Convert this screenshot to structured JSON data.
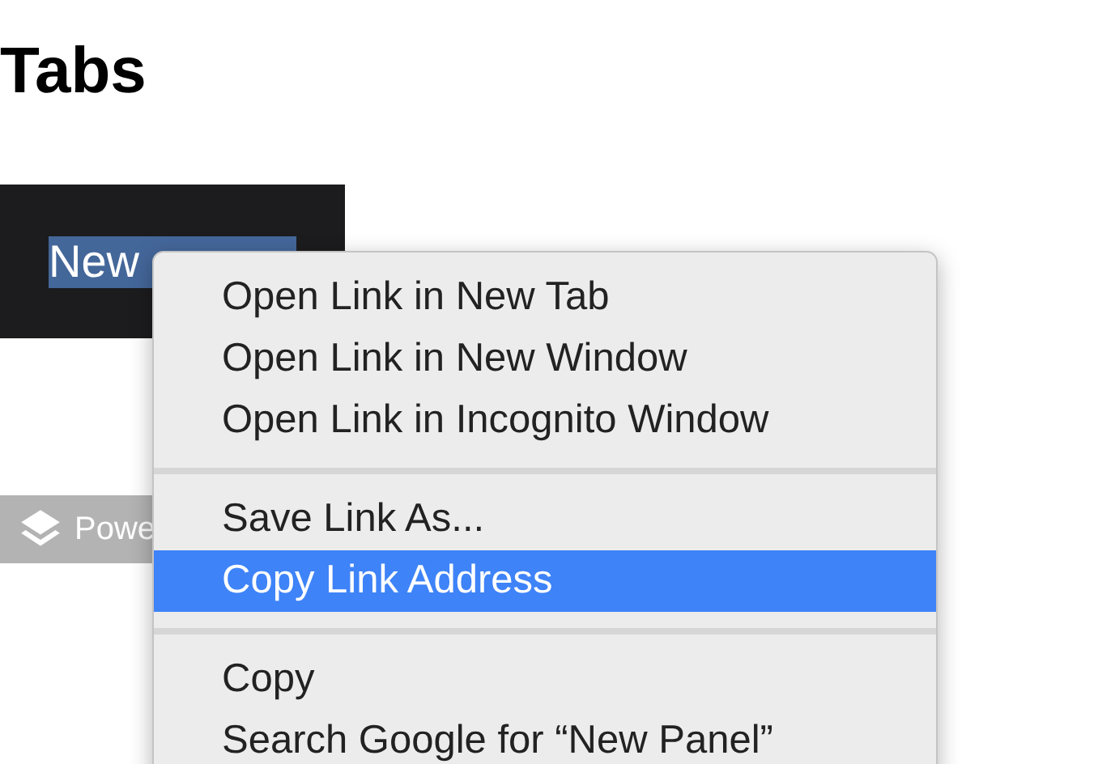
{
  "heading": "Tabs",
  "panel": {
    "tab_label": "New",
    "selected": true
  },
  "badge": {
    "label": "Powe"
  },
  "context_menu": {
    "items": [
      {
        "kind": "item",
        "label": "Open Link in New Tab",
        "selected": false
      },
      {
        "kind": "item",
        "label": "Open Link in New Window",
        "selected": false
      },
      {
        "kind": "item",
        "label": "Open Link in Incognito Window",
        "selected": false
      },
      {
        "kind": "separator"
      },
      {
        "kind": "item",
        "label": "Save Link As...",
        "selected": false
      },
      {
        "kind": "item",
        "label": "Copy Link Address",
        "selected": true
      },
      {
        "kind": "separator"
      },
      {
        "kind": "item",
        "label": "Copy",
        "selected": false
      },
      {
        "kind": "item",
        "label": "Search Google for “New Panel”",
        "selected": false
      }
    ]
  }
}
